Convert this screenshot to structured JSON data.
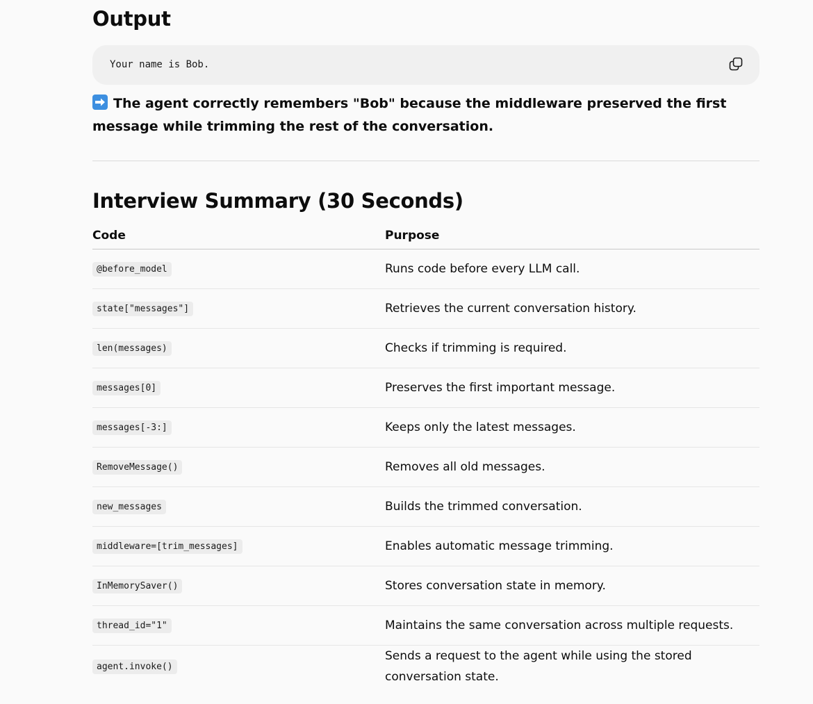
{
  "output_section": {
    "heading": "Output",
    "code_text": "Your name is Bob.",
    "copy_icon": "copy-icon",
    "note_icon": "right-arrow-emoji",
    "note_text": "The agent correctly remembers \"Bob\" because the middleware preserved the first message while trimming the rest of the conversation."
  },
  "summary_section": {
    "heading": "Interview Summary (30 Seconds)",
    "columns": [
      "Code",
      "Purpose"
    ],
    "rows": [
      {
        "code": "@before_model",
        "purpose": "Runs code before every LLM call."
      },
      {
        "code": "state[\"messages\"]",
        "purpose": "Retrieves the current conversation history."
      },
      {
        "code": "len(messages)",
        "purpose": "Checks if trimming is required."
      },
      {
        "code": "messages[0]",
        "purpose": "Preserves the first important message."
      },
      {
        "code": "messages[-3:]",
        "purpose": "Keeps only the latest messages."
      },
      {
        "code": "RemoveMessage()",
        "purpose": "Removes all old messages."
      },
      {
        "code": "new_messages",
        "purpose": "Builds the trimmed conversation."
      },
      {
        "code": "middleware=[trim_messages]",
        "purpose": "Enables automatic message trimming."
      },
      {
        "code": "InMemorySaver()",
        "purpose": "Stores conversation state in memory."
      },
      {
        "code": "thread_id=\"1\"",
        "purpose": "Maintains the same conversation across multiple requests."
      },
      {
        "code": "agent.invoke()",
        "purpose": "Sends a request to the agent while using the stored conversation state."
      }
    ]
  },
  "colors": {
    "page_background": "#fafafa",
    "code_block_background": "#f0f0f0",
    "inline_code_background": "#ececec",
    "emoji_blue": "#3d8fe0"
  }
}
